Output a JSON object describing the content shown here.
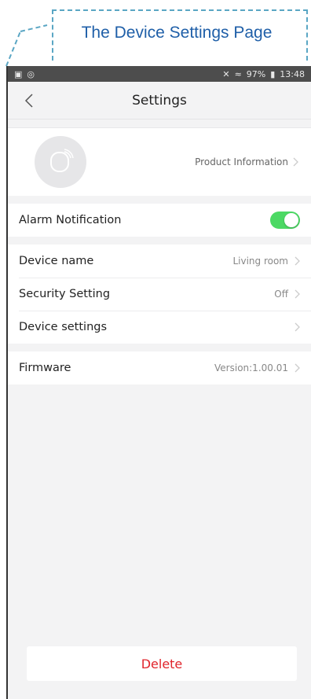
{
  "annotation": {
    "title": "The Device Settings Page"
  },
  "status_bar": {
    "icons_left": [
      "image-icon",
      "circle-icon"
    ],
    "signal_text": "97%",
    "time": "13:48"
  },
  "header": {
    "title": "Settings"
  },
  "product": {
    "link_label": "Product Information"
  },
  "alarm": {
    "label": "Alarm Notification",
    "enabled": true
  },
  "device_rows": [
    {
      "label": "Device name",
      "value": "Living room"
    },
    {
      "label": "Security Setting",
      "value": "Off"
    },
    {
      "label": "Device settings",
      "value": ""
    }
  ],
  "firmware": {
    "label": "Firmware",
    "value": "Version:1.00.01"
  },
  "footer": {
    "delete_label": "Delete"
  },
  "colors": {
    "toggle_on": "#4cd964",
    "delete_text": "#e0242b",
    "annotation_text": "#1f5fa8",
    "annotation_border": "#5aa6c4"
  }
}
